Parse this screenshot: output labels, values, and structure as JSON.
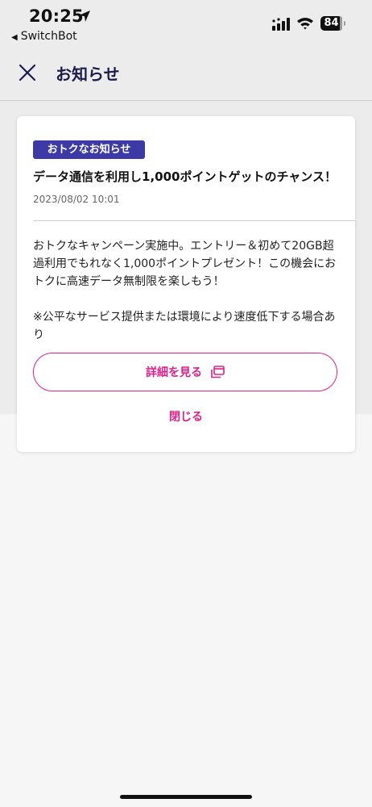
{
  "status_bar": {
    "time": "20:25",
    "back_app": "SwitchBot",
    "battery": "84",
    "icons": [
      "location-arrow-icon",
      "cellular-signal-icon",
      "wifi-icon",
      "battery-icon"
    ]
  },
  "header": {
    "title": "お知らせ",
    "close_icon": "close-icon"
  },
  "notice": {
    "tag": "おトクなお知らせ",
    "title": "データ通信を利用し1,000ポイントゲットのチャンス！",
    "date": "2023/08/02 10:01",
    "body_paragraph_1": "おトクなキャンペーン実施中。エントリー＆初めて20GB超過利用でもれなく1,000ポイントプレゼント！この機会におトクに高速データ無制限を楽しもう！",
    "body_paragraph_2": "※公平なサービス提供または環境により速度低下する場合あり",
    "detail_button": "詳細を見る",
    "detail_icon": "external-window-icon",
    "close_button": "閉じる"
  },
  "colors": {
    "accent": "#e0218a",
    "tag_bg": "#3d3aa6",
    "header_text": "#1c1c4a",
    "background_band": "#ececec",
    "background": "#f6f6f6"
  }
}
